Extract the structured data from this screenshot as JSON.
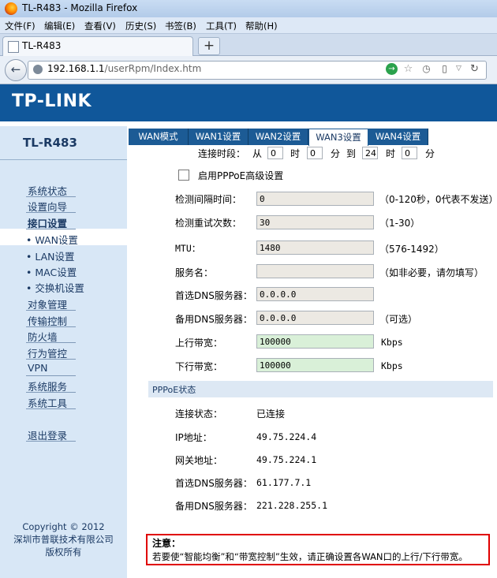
{
  "browser": {
    "window_title": "TL-R483 - Mozilla Firefox",
    "menu": [
      "文件(F)",
      "编辑(E)",
      "查看(V)",
      "历史(S)",
      "书签(B)",
      "工具(T)",
      "帮助(H)"
    ],
    "tab_title": "TL-R483",
    "new_tab": "+",
    "url_host": "192.168.1.1",
    "url_path": "/userRpm/Index.htm"
  },
  "header": {
    "logo": "TP-LINK"
  },
  "sidebar": {
    "model": "TL-R483",
    "items": [
      {
        "label": "系统状态"
      },
      {
        "label": "设置向导"
      },
      {
        "label": "接口设置"
      },
      {
        "label": "• WAN设置"
      },
      {
        "label": "• LAN设置"
      },
      {
        "label": "• MAC设置"
      },
      {
        "label": "• 交换机设置"
      },
      {
        "label": "对象管理"
      },
      {
        "label": "传输控制"
      },
      {
        "label": "防火墙"
      },
      {
        "label": "行为管控"
      },
      {
        "label": "VPN"
      },
      {
        "label": "系统服务"
      },
      {
        "label": "系统工具"
      },
      {
        "label": "退出登录"
      }
    ],
    "footer": [
      "Copyright © 2012",
      "深圳市普联技术有限公司",
      "版权所有"
    ]
  },
  "tabs": [
    "WAN模式",
    "WAN1设置",
    "WAN2设置",
    "WAN3设置",
    "WAN4设置"
  ],
  "form": {
    "period_label": "连接时段：",
    "from": "从",
    "hour": "时",
    "minute": "分",
    "to": "到",
    "start_hour": "0",
    "start_min": "0",
    "end_hour": "24",
    "end_min": "0",
    "advanced_label": "启用PPPoE高级设置",
    "fields": [
      {
        "label": "检测间隔时间：",
        "value": "0",
        "hint": "（0-120秒，0代表不发送）"
      },
      {
        "label": "检测重试次数：",
        "value": "30",
        "hint": "（1-30）"
      },
      {
        "label": "MTU：",
        "value": "1480",
        "hint": "（576-1492）"
      },
      {
        "label": "服务名：",
        "value": "",
        "hint": "（如非必要，请勿填写）"
      },
      {
        "label": "首选DNS服务器：",
        "value": "0.0.0.0",
        "hint": ""
      },
      {
        "label": "备用DNS服务器：",
        "value": "0.0.0.0",
        "hint": "（可选）"
      },
      {
        "label": "上行带宽：",
        "value": "100000",
        "hint": "Kbps"
      },
      {
        "label": "下行带宽：",
        "value": "100000",
        "hint": "Kbps"
      }
    ]
  },
  "status": {
    "title": "PPPoE状态",
    "rows": [
      {
        "label": "连接状态：",
        "value": "已连接"
      },
      {
        "label": "IP地址：",
        "value": "49.75.224.4"
      },
      {
        "label": "网关地址：",
        "value": "49.75.224.1"
      },
      {
        "label": "首选DNS服务器：",
        "value": "61.177.7.1"
      },
      {
        "label": "备用DNS服务器：",
        "value": "221.228.255.1"
      }
    ]
  },
  "notice": {
    "title": "注意：",
    "body": "若要使“智能均衡”和“带宽控制”生效，请正确设置各WAN口的上行/下行带宽。"
  }
}
